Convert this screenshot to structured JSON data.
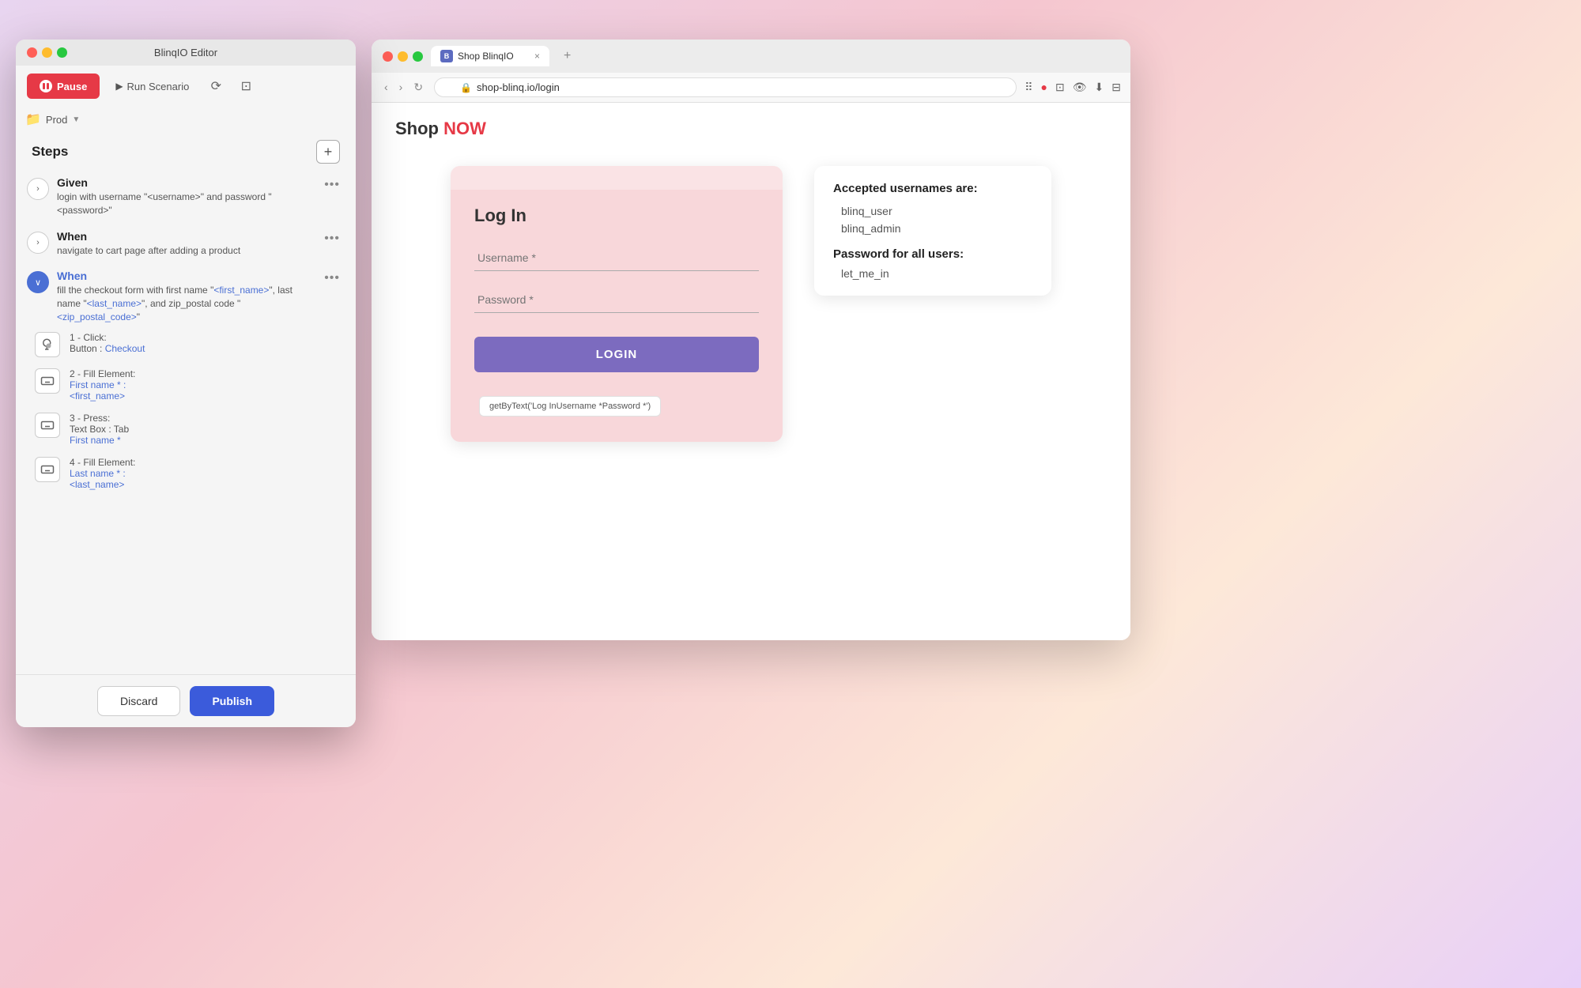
{
  "editor": {
    "title": "BlinqIO Editor",
    "buttons": {
      "pause": "Pause",
      "run_scenario": "Run Scenario",
      "discard": "Discard",
      "publish": "Publish"
    },
    "env": "Prod",
    "steps_title": "Steps",
    "steps": [
      {
        "id": 1,
        "type": "Given",
        "description": "login with username \"<username>\" and password \"<password>\"",
        "expanded": false
      },
      {
        "id": 2,
        "type": "When",
        "description": "navigate to cart page after adding a product",
        "expanded": false
      },
      {
        "id": 3,
        "type": "When",
        "description": "fill the checkout form with first name \"<first_name>\", last name \"<last_name>\", and zip_postal code \"<zip_postal_code>\"",
        "expanded": true
      }
    ],
    "sub_steps": [
      {
        "number": "1",
        "action": "Click:",
        "detail1": "Button :",
        "detail2": "Checkout",
        "icon": "click"
      },
      {
        "number": "2",
        "action": "Fill Element:",
        "detail1": "First name * :",
        "detail2": "<first_name>",
        "icon": "keyboard"
      },
      {
        "number": "3",
        "action": "Press:",
        "detail1": "Text Box : Tab",
        "detail2": "First name *",
        "icon": "keyboard"
      },
      {
        "number": "4",
        "action": "Fill Element:",
        "detail1": "Last name * :",
        "detail2": "<last_name>",
        "icon": "keyboard"
      }
    ]
  },
  "browser": {
    "tab_title": "Shop BlinqIO",
    "url": "shop-blinq.io/login",
    "new_tab_label": "+",
    "close_tab": "×"
  },
  "shop": {
    "title_prefix": "Shop ",
    "title_highlight": "NOW",
    "login": {
      "title": "Log In",
      "username_label": "Username *",
      "password_label": "Password *",
      "button": "LOGIN",
      "tooltip": "getByText('Log InUsername *Password *')"
    },
    "info": {
      "title": "Accepted usernames are:",
      "usernames": [
        "blinq_user",
        "blinq_admin"
      ],
      "password_title": "Password for all users:",
      "password": "let_me_in"
    }
  }
}
